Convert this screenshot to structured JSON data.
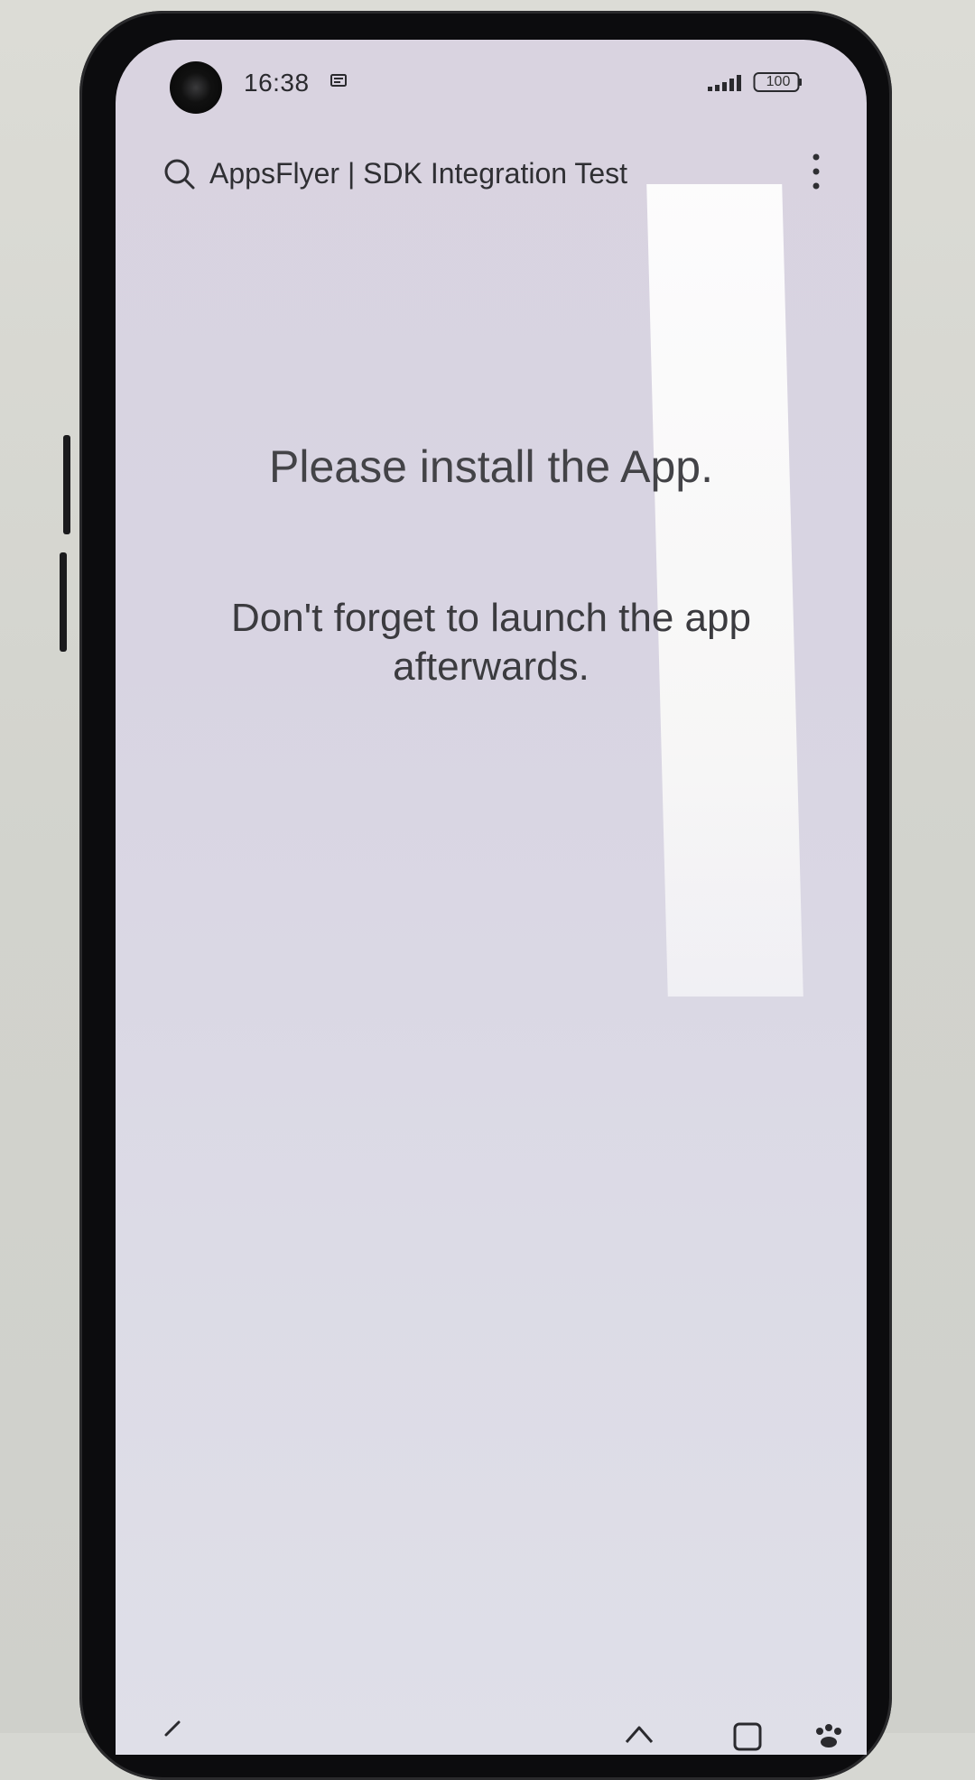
{
  "status_bar": {
    "time": "16:38",
    "battery_level": "100",
    "icons": [
      "message-icon",
      "signal-icon",
      "battery-icon"
    ]
  },
  "search_bar": {
    "title": "AppsFlyer | SDK Integration Test",
    "icons": [
      "search-icon",
      "more-vert-icon"
    ]
  },
  "main": {
    "heading": "Please install the App.",
    "subtext": "Don't forget to launch the app afterwards."
  },
  "nav_bar": {
    "icons": [
      "back-icon",
      "home-icon",
      "recents-icon",
      "assistant-icon"
    ]
  },
  "colors": {
    "screen_background": "#dbd7e3",
    "text_primary": "#434347",
    "phone_frame": "#0c0c0e"
  }
}
